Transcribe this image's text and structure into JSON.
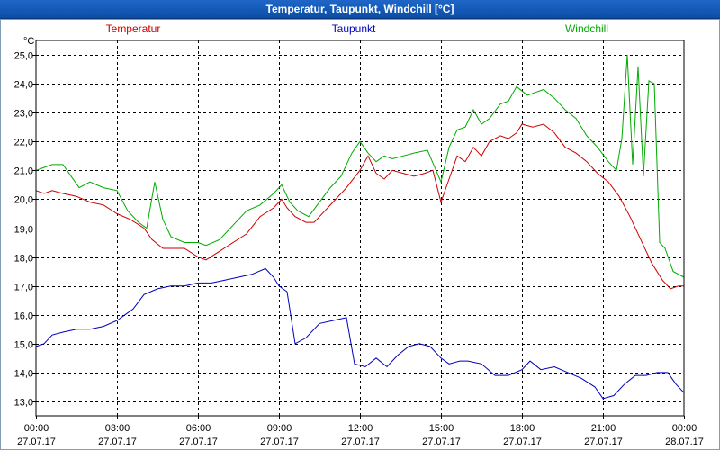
{
  "window": {
    "title": "Temperatur, Taupunkt, Windchill [°C]"
  },
  "chart_data": {
    "type": "line",
    "ylabel": "°C",
    "ylim": [
      12.5,
      25.5
    ],
    "xlim": [
      0,
      24
    ],
    "grid": true,
    "legend_position": "top",
    "y_ticks": [
      "25,0",
      "24,0",
      "23,0",
      "22,0",
      "21,0",
      "20,0",
      "19,0",
      "18,0",
      "17,0",
      "16,0",
      "15,0",
      "14,0",
      "13,0"
    ],
    "y_tick_values": [
      25,
      24,
      23,
      22,
      21,
      20,
      19,
      18,
      17,
      16,
      15,
      14,
      13
    ],
    "x_tick_times": [
      "00:00",
      "03:00",
      "06:00",
      "09:00",
      "12:00",
      "15:00",
      "18:00",
      "21:00",
      "00:00"
    ],
    "x_tick_dates": [
      "27.07.17",
      "27.07.17",
      "27.07.17",
      "27.07.17",
      "27.07.17",
      "27.07.17",
      "27.07.17",
      "27.07.17",
      "28.07.17"
    ],
    "x_tick_values": [
      0,
      3,
      6,
      9,
      12,
      15,
      18,
      21,
      24
    ],
    "series": [
      {
        "name": "Temperatur",
        "color": "#cc0000",
        "points": [
          [
            0,
            20.3
          ],
          [
            0.3,
            20.2
          ],
          [
            0.6,
            20.3
          ],
          [
            1,
            20.2
          ],
          [
            1.5,
            20.1
          ],
          [
            2,
            19.9
          ],
          [
            2.5,
            19.8
          ],
          [
            3,
            19.5
          ],
          [
            3.5,
            19.3
          ],
          [
            4,
            19.0
          ],
          [
            4.3,
            18.6
          ],
          [
            4.7,
            18.3
          ],
          [
            5.2,
            18.3
          ],
          [
            5.5,
            18.3
          ],
          [
            6,
            18.0
          ],
          [
            6.3,
            17.9
          ],
          [
            6.8,
            18.2
          ],
          [
            7.3,
            18.5
          ],
          [
            7.8,
            18.8
          ],
          [
            8.3,
            19.4
          ],
          [
            8.8,
            19.7
          ],
          [
            9.1,
            20.0
          ],
          [
            9.3,
            19.7
          ],
          [
            9.6,
            19.4
          ],
          [
            10,
            19.2
          ],
          [
            10.3,
            19.2
          ],
          [
            10.7,
            19.6
          ],
          [
            11,
            19.9
          ],
          [
            11.5,
            20.4
          ],
          [
            12,
            21.0
          ],
          [
            12.3,
            21.5
          ],
          [
            12.6,
            20.9
          ],
          [
            12.9,
            20.7
          ],
          [
            13.2,
            21.0
          ],
          [
            13.6,
            20.9
          ],
          [
            14,
            20.8
          ],
          [
            14.4,
            20.9
          ],
          [
            14.7,
            21.0
          ],
          [
            15,
            19.9
          ],
          [
            15.3,
            20.7
          ],
          [
            15.6,
            21.5
          ],
          [
            15.9,
            21.3
          ],
          [
            16.2,
            21.8
          ],
          [
            16.5,
            21.5
          ],
          [
            16.8,
            22.0
          ],
          [
            17.2,
            22.2
          ],
          [
            17.5,
            22.1
          ],
          [
            17.8,
            22.3
          ],
          [
            18,
            22.6
          ],
          [
            18.4,
            22.5
          ],
          [
            18.8,
            22.6
          ],
          [
            19.2,
            22.3
          ],
          [
            19.6,
            21.8
          ],
          [
            20,
            21.6
          ],
          [
            20.4,
            21.3
          ],
          [
            20.8,
            20.9
          ],
          [
            21.2,
            20.6
          ],
          [
            21.6,
            20.1
          ],
          [
            22,
            19.4
          ],
          [
            22.4,
            18.6
          ],
          [
            22.8,
            17.8
          ],
          [
            23.2,
            17.2
          ],
          [
            23.5,
            16.9
          ],
          [
            23.8,
            17.0
          ],
          [
            24,
            17.0
          ]
        ]
      },
      {
        "name": "Taupunkt",
        "color": "#0000bb",
        "points": [
          [
            0,
            14.9
          ],
          [
            0.3,
            15.0
          ],
          [
            0.6,
            15.3
          ],
          [
            1,
            15.4
          ],
          [
            1.5,
            15.5
          ],
          [
            2,
            15.5
          ],
          [
            2.5,
            15.6
          ],
          [
            3,
            15.8
          ],
          [
            3.3,
            16.0
          ],
          [
            3.6,
            16.2
          ],
          [
            4,
            16.7
          ],
          [
            4.5,
            16.9
          ],
          [
            5,
            17.0
          ],
          [
            5.5,
            17.0
          ],
          [
            6,
            17.1
          ],
          [
            6.5,
            17.1
          ],
          [
            7,
            17.2
          ],
          [
            7.5,
            17.3
          ],
          [
            8,
            17.4
          ],
          [
            8.5,
            17.6
          ],
          [
            8.8,
            17.3
          ],
          [
            9,
            17.0
          ],
          [
            9.3,
            16.8
          ],
          [
            9.6,
            15.0
          ],
          [
            10,
            15.2
          ],
          [
            10.5,
            15.7
          ],
          [
            11,
            15.8
          ],
          [
            11.5,
            15.9
          ],
          [
            11.8,
            14.3
          ],
          [
            12.2,
            14.2
          ],
          [
            12.6,
            14.5
          ],
          [
            13,
            14.2
          ],
          [
            13.4,
            14.6
          ],
          [
            13.8,
            14.9
          ],
          [
            14.2,
            15.0
          ],
          [
            14.6,
            14.9
          ],
          [
            15,
            14.5
          ],
          [
            15.3,
            14.3
          ],
          [
            15.7,
            14.4
          ],
          [
            16,
            14.4
          ],
          [
            16.5,
            14.3
          ],
          [
            17,
            13.9
          ],
          [
            17.5,
            13.9
          ],
          [
            18,
            14.1
          ],
          [
            18.3,
            14.4
          ],
          [
            18.7,
            14.1
          ],
          [
            19.2,
            14.2
          ],
          [
            19.7,
            14.0
          ],
          [
            20.2,
            13.8
          ],
          [
            20.7,
            13.5
          ],
          [
            21,
            13.1
          ],
          [
            21.4,
            13.2
          ],
          [
            21.8,
            13.6
          ],
          [
            22.2,
            13.9
          ],
          [
            22.6,
            13.9
          ],
          [
            23,
            14.0
          ],
          [
            23.4,
            14.0
          ],
          [
            23.7,
            13.6
          ],
          [
            24,
            13.3
          ]
        ]
      },
      {
        "name": "Windchill",
        "color": "#00aa00",
        "points": [
          [
            0,
            21.0
          ],
          [
            0.3,
            21.1
          ],
          [
            0.6,
            21.2
          ],
          [
            1,
            21.2
          ],
          [
            1.3,
            20.8
          ],
          [
            1.6,
            20.4
          ],
          [
            2,
            20.6
          ],
          [
            2.5,
            20.4
          ],
          [
            3,
            20.3
          ],
          [
            3.4,
            19.6
          ],
          [
            3.8,
            19.2
          ],
          [
            4.1,
            19.0
          ],
          [
            4.4,
            20.6
          ],
          [
            4.7,
            19.3
          ],
          [
            5,
            18.7
          ],
          [
            5.5,
            18.5
          ],
          [
            6,
            18.5
          ],
          [
            6.3,
            18.4
          ],
          [
            6.8,
            18.6
          ],
          [
            7.3,
            19.1
          ],
          [
            7.8,
            19.6
          ],
          [
            8.3,
            19.8
          ],
          [
            8.8,
            20.2
          ],
          [
            9.1,
            20.5
          ],
          [
            9.4,
            19.9
          ],
          [
            9.7,
            19.6
          ],
          [
            10.1,
            19.4
          ],
          [
            10.5,
            19.9
          ],
          [
            10.9,
            20.4
          ],
          [
            11.3,
            20.8
          ],
          [
            11.7,
            21.6
          ],
          [
            12,
            22.0
          ],
          [
            12.3,
            21.6
          ],
          [
            12.6,
            21.3
          ],
          [
            12.9,
            21.5
          ],
          [
            13.2,
            21.4
          ],
          [
            13.6,
            21.5
          ],
          [
            14,
            21.6
          ],
          [
            14.5,
            21.7
          ],
          [
            15,
            20.6
          ],
          [
            15.3,
            21.8
          ],
          [
            15.6,
            22.4
          ],
          [
            15.9,
            22.5
          ],
          [
            16.2,
            23.1
          ],
          [
            16.5,
            22.6
          ],
          [
            16.8,
            22.8
          ],
          [
            17.2,
            23.3
          ],
          [
            17.5,
            23.4
          ],
          [
            17.8,
            23.9
          ],
          [
            18.2,
            23.6
          ],
          [
            18.5,
            23.7
          ],
          [
            18.8,
            23.8
          ],
          [
            19.2,
            23.5
          ],
          [
            19.6,
            23.1
          ],
          [
            20,
            22.8
          ],
          [
            20.4,
            22.2
          ],
          [
            20.8,
            21.8
          ],
          [
            21.2,
            21.3
          ],
          [
            21.5,
            21.0
          ],
          [
            21.7,
            22.1
          ],
          [
            21.9,
            25.0
          ],
          [
            22.1,
            21.2
          ],
          [
            22.3,
            24.6
          ],
          [
            22.5,
            20.8
          ],
          [
            22.7,
            24.1
          ],
          [
            22.9,
            24.0
          ],
          [
            23.1,
            18.5
          ],
          [
            23.3,
            18.3
          ],
          [
            23.6,
            17.5
          ],
          [
            24,
            17.3
          ]
        ]
      }
    ]
  }
}
